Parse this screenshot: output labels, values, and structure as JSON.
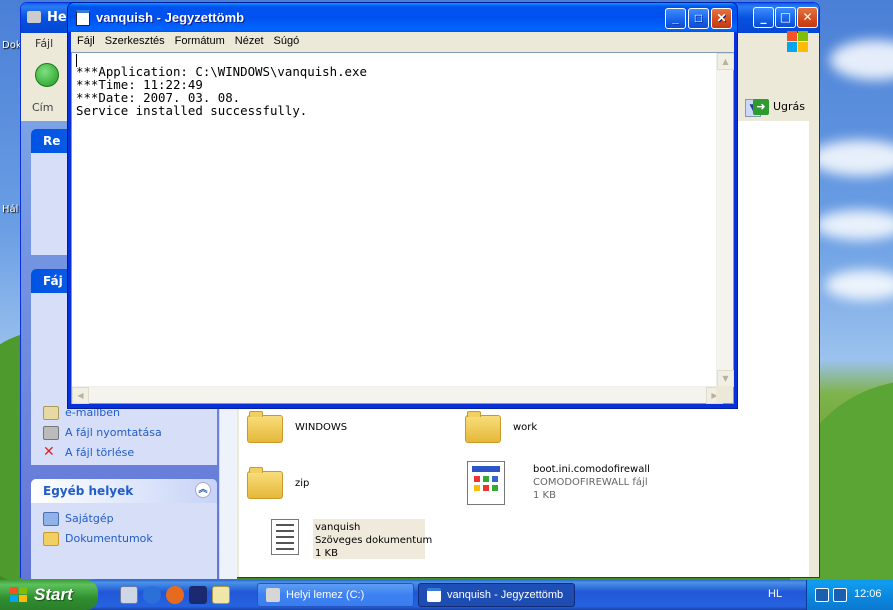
{
  "desktop": {
    "labels": [
      "Dok",
      "Hál"
    ]
  },
  "explorer": {
    "title": "Hel",
    "menu_first": "Fájl",
    "address_label": "Cím",
    "go_label": "Ugrás",
    "taskpane": {
      "box1_title": "Re",
      "box2_title": "Fáj",
      "email_item": "e-mailben",
      "print_item": "A fájl nyomtatása",
      "delete_item": "A fájl törlése",
      "other_places_title": "Egyéb helyek",
      "other_items": [
        "Sajátgép",
        "Dokumentumok"
      ]
    },
    "files": [
      {
        "name": "WINDOWS",
        "type": "folder"
      },
      {
        "name": "work",
        "type": "folder"
      },
      {
        "name": "zip",
        "type": "folder"
      },
      {
        "name": "boot.ini.comodofirewall",
        "subtitle": "COMODOFIREWALL fájl",
        "size": "1 KB",
        "type": "file"
      },
      {
        "name": "vanquish",
        "subtitle": "Szöveges dokumentum",
        "size": "1 KB",
        "type": "text"
      }
    ]
  },
  "notepad": {
    "title": "vanquish - Jegyzettömb",
    "menu": [
      "Fájl",
      "Szerkesztés",
      "Formátum",
      "Nézet",
      "Súgó"
    ],
    "content": "***Application: C:\\WINDOWS\\vanquish.exe\n***Time: 11:22:49\n***Date: 2007. 03. 08.\nService installed successfully."
  },
  "taskbar": {
    "start_label": "Start",
    "tasks": [
      {
        "label": "Helyi lemez (C:)",
        "active": false
      },
      {
        "label": "vanquish - Jegyzettömb",
        "active": true
      }
    ],
    "language": "HL",
    "clock": "12:06"
  },
  "colors": {
    "xp_blue": "#0054e3",
    "start_green": "#3c9e3c",
    "close_red": "#d34a1c"
  }
}
